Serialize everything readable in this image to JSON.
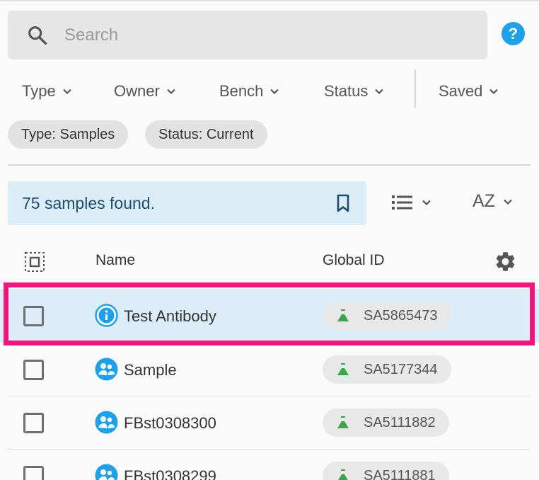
{
  "search": {
    "placeholder": "Search"
  },
  "help": {
    "label": "?"
  },
  "filters": [
    {
      "label": "Type"
    },
    {
      "label": "Owner"
    },
    {
      "label": "Bench"
    },
    {
      "label": "Status"
    },
    {
      "label": "Saved"
    }
  ],
  "active_filters": [
    {
      "label": "Type: Samples"
    },
    {
      "label": "Status: Current"
    }
  ],
  "results": {
    "text": "75 samples found."
  },
  "sort": {
    "label": "AZ"
  },
  "table": {
    "columns": {
      "name": "Name",
      "global_id": "Global ID"
    },
    "rows": [
      {
        "name": "Test Antibody",
        "global_id": "SA5865473",
        "icon": "info-icon",
        "selected": true
      },
      {
        "name": "Sample",
        "global_id": "SA5177344",
        "icon": "sample-group-icon",
        "selected": false
      },
      {
        "name": "FBst0308300",
        "global_id": "SA5111882",
        "icon": "sample-group-icon",
        "selected": false
      },
      {
        "name": "FBst0308299",
        "global_id": "SA5111881",
        "icon": "sample-group-icon",
        "selected": false
      }
    ]
  },
  "colors": {
    "accent": "#1ea1e8",
    "highlight": "#f0167c",
    "flask": "#3aa64c",
    "selected_row": "#dcedfa"
  }
}
